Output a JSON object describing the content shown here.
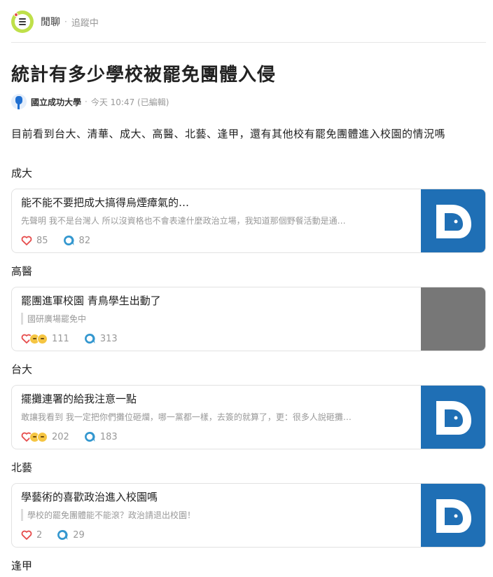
{
  "board": {
    "name": "閒聊",
    "separator": "·",
    "follow_status": "追蹤中"
  },
  "post": {
    "title": "統計有多少學校被罷免團體入侵",
    "author_school": "國立成功大學",
    "meta_separator": "·",
    "time": "今天 10:47 (已編輯)",
    "body": "目前看到台大、清華、成大、高醫、北藝、逢甲，還有其他校有罷免團體進入校園的情況嗎"
  },
  "sections": [
    {
      "label": "成大",
      "card": {
        "title": "能不能不要把成大搞得烏煙瘴氣的…",
        "excerpt": "先聲明 我不是台灣人 所以沒資格也不會表達什麼政治立場，我知道那個野餐活動是通…",
        "likes": "85",
        "comments": "82"
      }
    },
    {
      "label": "高醫",
      "card": {
        "title": "罷團進軍校園 青鳥學生出動了",
        "excerpt": "國研廣場罷免中",
        "likes": "111",
        "comments": "313"
      }
    },
    {
      "label": "台大",
      "card": {
        "title": "擺攤連署的給我注意一點",
        "excerpt": "敢讓我看到 我一定把你們攤位砸爛，哪一黨都一樣，去簽的就算了，更：很多人說砸攤…",
        "likes": "202",
        "comments": "183"
      }
    },
    {
      "label": "北藝",
      "card": {
        "title": "學藝術的喜歡政治進入校園嗎",
        "excerpt": "學校的罷免團體能不能滾？政治請退出校園！",
        "likes": "2",
        "comments": "29"
      }
    },
    {
      "label": "逢甲"
    }
  ],
  "colors": {
    "accent": "#1f6fb5",
    "heart": "#e64c4c",
    "board_icon": "#bfe04a"
  }
}
